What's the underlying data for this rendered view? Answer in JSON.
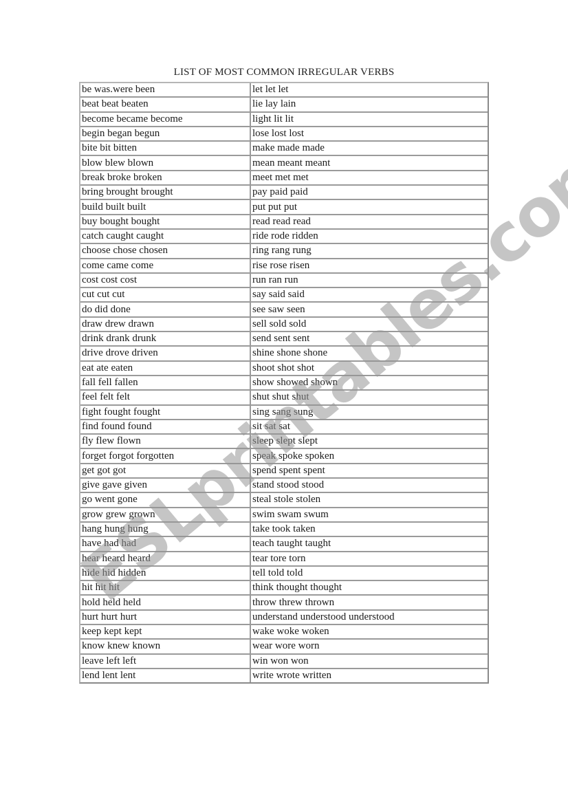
{
  "document": {
    "title": "LIST OF MOST COMMON IRREGULAR VERBS",
    "watermark": "ESLprintables.com"
  },
  "table": {
    "rows": [
      {
        "left": "be was.were been",
        "right": "let let let"
      },
      {
        "left": "beat beat beaten",
        "right": "lie lay lain"
      },
      {
        "left": "become became become",
        "right": "light lit lit"
      },
      {
        "left": "begin began begun",
        "right": "lose lost lost"
      },
      {
        "left": "bite bit bitten",
        "right": "make made made"
      },
      {
        "left": "blow blew blown",
        "right": "mean meant meant"
      },
      {
        "left": "break broke broken",
        "right": "meet met met"
      },
      {
        "left": "bring brought brought",
        "right": "pay paid paid"
      },
      {
        "left": "build built built",
        "right": "put put put"
      },
      {
        "left": "buy bought bought",
        "right": "read read read"
      },
      {
        "left": "catch caught caught",
        "right": "ride rode ridden"
      },
      {
        "left": "choose chose chosen",
        "right": "ring rang rung"
      },
      {
        "left": "come came come",
        "right": "rise rose risen"
      },
      {
        "left": "cost cost cost",
        "right": "run ran run"
      },
      {
        "left": "cut cut cut",
        "right": "say said said"
      },
      {
        "left": "do did done",
        "right": "see saw seen"
      },
      {
        "left": "draw drew drawn",
        "right": "sell sold sold"
      },
      {
        "left": "drink drank drunk",
        "right": "send sent sent"
      },
      {
        "left": "drive drove driven",
        "right": "shine shone shone"
      },
      {
        "left": "eat ate eaten",
        "right": "shoot shot shot"
      },
      {
        "left": "fall fell fallen",
        "right": "show showed shown"
      },
      {
        "left": "feel felt felt",
        "right": "shut shut shut"
      },
      {
        "left": "fight fought fought",
        "right": "sing sang sung"
      },
      {
        "left": "find found found",
        "right": "sit sat sat"
      },
      {
        "left": "fly flew flown",
        "right": "sleep slept slept"
      },
      {
        "left": "forget forgot forgotten",
        "right": "speak spoke spoken"
      },
      {
        "left": "get got got",
        "right": "spend spent spent"
      },
      {
        "left": "give gave given",
        "right": "stand stood stood"
      },
      {
        "left": "go went gone",
        "right": "steal stole stolen"
      },
      {
        "left": "grow grew grown",
        "right": "swim swam swum"
      },
      {
        "left": "hang hung hung",
        "right": "take took taken"
      },
      {
        "left": "have had had",
        "right": "teach taught taught"
      },
      {
        "left": "hear heard heard",
        "right": "tear tore torn"
      },
      {
        "left": "hide hid hidden",
        "right": "tell told told"
      },
      {
        "left": "hit hit hit",
        "right": "think thought thought"
      },
      {
        "left": "hold held held",
        "right": "throw threw thrown"
      },
      {
        "left": "hurt hurt hurt",
        "right": "understand understood understood"
      },
      {
        "left": "keep kept kept",
        "right": "wake woke woken"
      },
      {
        "left": "know knew known",
        "right": "wear wore worn"
      },
      {
        "left": "leave left left",
        "right": "win won won"
      },
      {
        "left": "lend lent lent",
        "right": "write wrote written"
      }
    ]
  }
}
